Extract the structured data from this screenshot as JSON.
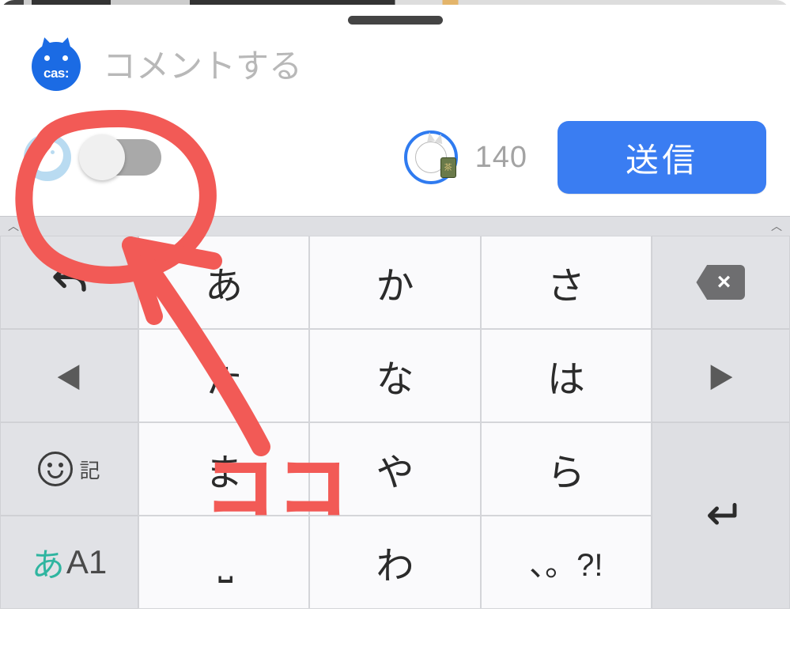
{
  "avatar": {
    "label": "cas:"
  },
  "comment": {
    "placeholder": "コメントする",
    "value": ""
  },
  "counter": "140",
  "send_label": "送信",
  "annotation_text": "ココ",
  "keyboard": {
    "rows": [
      {
        "side_left": "undo",
        "k1": "あ",
        "k2": "か",
        "k3": "さ",
        "side_right": "backspace"
      },
      {
        "side_left": "◀",
        "k1": "た",
        "k2": "な",
        "k3": "は",
        "side_right": "▶"
      },
      {
        "side_left_emoji_sub": "記",
        "k1": "ま",
        "k2": "や",
        "k3": "ら",
        "side_right": "enter"
      },
      {
        "side_left_mode_a": "あ",
        "side_left_mode_rest": "A1",
        "k1": "space",
        "k2": "わ",
        "k3": "、。?!",
        "side_right": ""
      }
    ]
  }
}
